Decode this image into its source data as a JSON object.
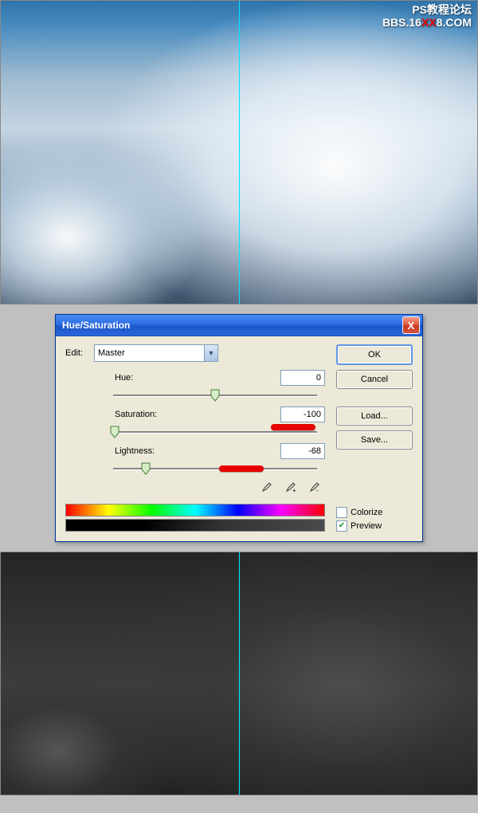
{
  "watermark": {
    "line1": "PS教程论坛",
    "line2_a": "BBS.16",
    "line2_b": "XX",
    "line2_c": "8.COM"
  },
  "dialog": {
    "title": "Hue/Saturation",
    "edit_label": "Edit:",
    "combo_value": "Master",
    "hue_label": "Hue:",
    "hue_value": "0",
    "sat_label": "Saturation:",
    "sat_value": "-100",
    "light_label": "Lightness:",
    "light_value": "-68",
    "ok": "OK",
    "cancel": "Cancel",
    "load": "Load...",
    "save": "Save...",
    "colorize": "Colorize",
    "preview": "Preview",
    "close": "X"
  }
}
